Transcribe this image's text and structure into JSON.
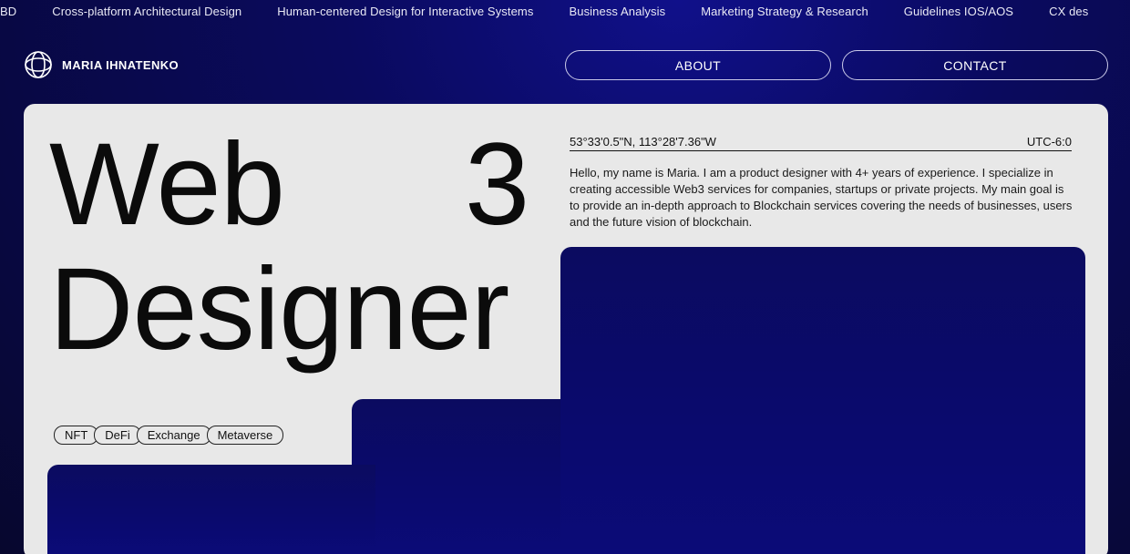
{
  "marquee": {
    "items": [
      "BD",
      "Cross-platform Architectural Design",
      "Human-centered Design for Interactive Systems",
      "Business Analysis",
      "Marketing Strategy & Research",
      "Guidelines IOS/AOS",
      "CX des"
    ]
  },
  "header": {
    "brand_name": "MARIA IHNATENKO",
    "about_label": "ABOUT",
    "contact_label": "CONTACT"
  },
  "hero": {
    "word1": "Web",
    "word2": "3",
    "word3": "Designer"
  },
  "info": {
    "coordinates": "53°33'0.5\"N, 113°28'7.36\"W",
    "timezone": "UTC-6:0",
    "bio": "Hello, my name is Maria. I am a product designer with 4+ years of experience. I specialize in creating accessible Web3 services for companies, startups or private projects. My main goal is to provide an in-depth approach to Blockchain services covering the needs of businesses, users and the future vision of blockchain."
  },
  "tags": [
    "NFT",
    "DeFi",
    "Exchange",
    "Metaverse"
  ],
  "colors": {
    "background": "#0a0a5e",
    "card": "#e8e8e8",
    "text_dark": "#0b0b0b"
  }
}
